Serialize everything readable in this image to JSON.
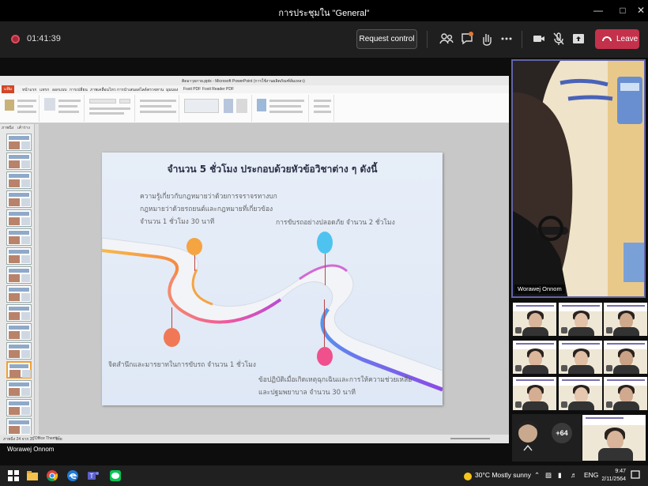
{
  "window": {
    "title": "การประชุมใน \"General\""
  },
  "meeting": {
    "timer": "01:41:39",
    "request_control": "Request control",
    "leave": "Leave"
  },
  "ppt": {
    "title": "ติดอาวุธกาย.pptx - Microsoft PowerPoint (การใช้งานผลิตภัณฑ์ล้มเหลว)",
    "file_tab": "แฟ้ม",
    "tabs": [
      "หน้าแรก",
      "แทรก",
      "ออกแบบ",
      "การเปลี่ยน",
      "ภาพเคลื่อนไหว",
      "การนำเสนอสไลด์",
      "ตรวจทาน",
      "มุมมอง",
      "Foxit PDF",
      "Foxit Reader PDF"
    ],
    "pane_tabs": [
      "ภาพนิ่ง",
      "เค้าร่าง"
    ],
    "status_left": "ภาพนิ่ง 24 จาก 35",
    "status_theme": "\"Office Theme\"",
    "status_lang": "ไทย"
  },
  "slide": {
    "heading": "จำนวน 5 ชั่วโมง ประกอบด้วยหัวข้อวิชาต่าง ๆ ดังนี้",
    "topic1_line1": "ความรู้เกี่ยวกับกฎหมายว่าด้วยการจราจรทางบก",
    "topic1_line2": "กฎหมายว่าด้วยรถยนต์และกฎหมายที่เกี่ยวข้อง",
    "topic1_line3": "จำนวน 1 ชั่วโมง 30 นาที",
    "topic2": "การขับรถอย่างปลอดภัย จำนวน 2 ชั่วโมง",
    "topic3": "จิตสำนึกและมารยาทในการขับรถ จำนวน 1 ชั่วโมง",
    "topic4_line1": "ข้อปฏิบัติเมื่อเกิดเหตุฉุกเฉินและการให้ความช่วยเหลือ",
    "topic4_line2": "และปฐมพยาบาล จำนวน 30 นาที"
  },
  "participants": {
    "main_speaker": "Worawej Onnom",
    "presenter": "Worawej Onnom",
    "more_count": "+64"
  },
  "taskbar": {
    "weather": "30°C  Mostly sunny",
    "lang": "ENG",
    "time": "9:47",
    "date": "2/11/2564"
  },
  "colors": {
    "leave": "#c4314b",
    "accent": "#6264a7",
    "dot_orange": "#f5a442",
    "dot_blue": "#4fc3f0",
    "dot_coral": "#f07856",
    "dot_pink": "#f0508c"
  }
}
